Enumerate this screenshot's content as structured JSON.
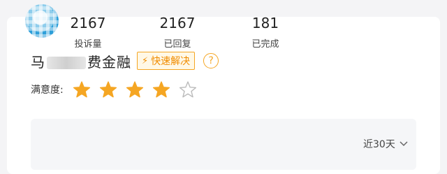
{
  "company": {
    "name_prefix": "马",
    "name_suffix": "费金融",
    "badge_label": "快速解决",
    "badge_icon": "lightning-icon",
    "help_icon": "question-circle-icon"
  },
  "rating": {
    "label": "满意度:",
    "value": 4,
    "max": 5,
    "filled_color": "#f5a623",
    "empty_color": "#bbbbbb"
  },
  "stats": [
    {
      "value": "2167",
      "label": "投诉量"
    },
    {
      "value": "2167",
      "label": "已回复"
    },
    {
      "value": "181",
      "label": "已完成"
    }
  ],
  "period": {
    "label": "近30天",
    "icon": "chevron-down-icon"
  },
  "colors": {
    "accent": "#f5a623",
    "badge_text": "#f08c00",
    "panel_bg": "#f5f6f8"
  }
}
